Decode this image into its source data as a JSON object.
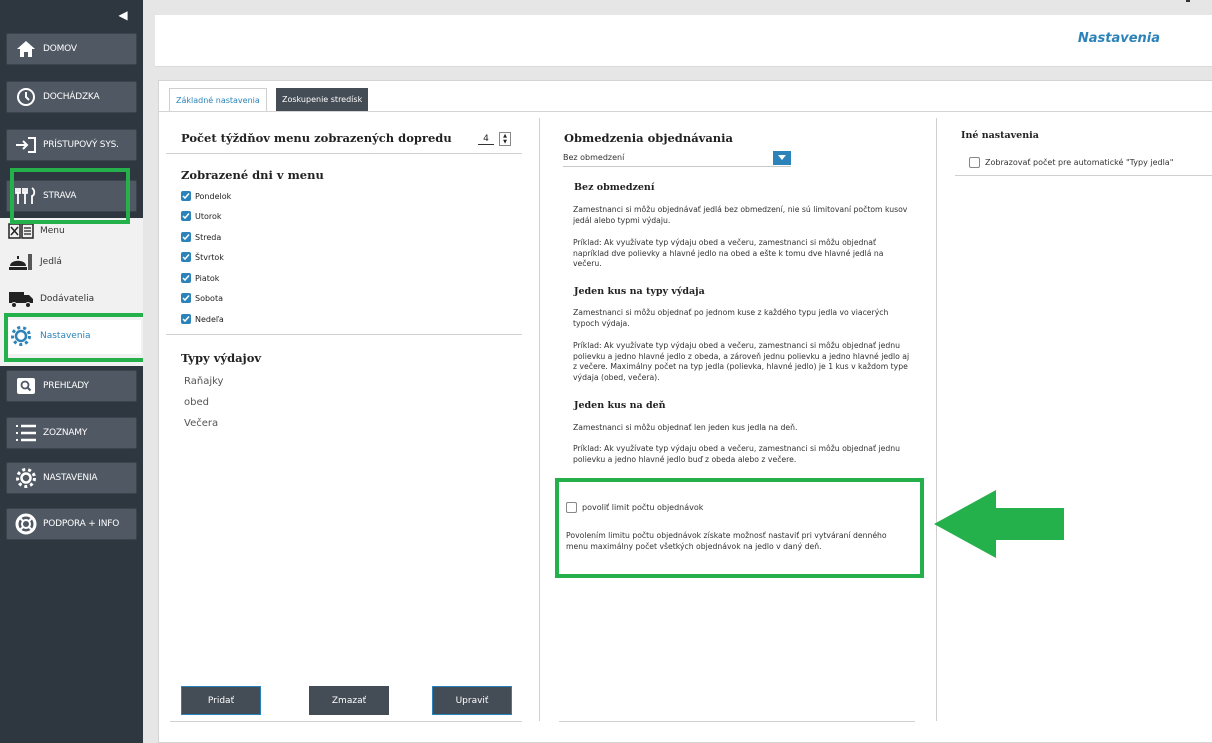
{
  "sidebar": {
    "collapse_icon": "caret-left-icon",
    "nav": [
      {
        "label": "DOMOV",
        "icon": "home-icon"
      },
      {
        "label": "DOCHÁDZKA",
        "icon": "clock-icon"
      },
      {
        "label": "PRÍSTUPOVÝ SYS.",
        "icon": "enter-icon"
      },
      {
        "label": "STRAVA",
        "icon": "cutlery-icon"
      }
    ],
    "strava_items": [
      {
        "label": "Menu",
        "icon": "menu-icon"
      },
      {
        "label": "Jedlá",
        "icon": "dish-icon"
      },
      {
        "label": "Dodávatelia",
        "icon": "truck-icon"
      },
      {
        "label": "Nastavenia",
        "icon": "gear-icon"
      }
    ],
    "nav_bottom": [
      {
        "label": "PREHĽADY",
        "icon": "search-icon"
      },
      {
        "label": "ZOZNAMY",
        "icon": "list-icon"
      },
      {
        "label": "NASTAVENIA",
        "icon": "gear-icon"
      },
      {
        "label": "PODPORA + INFO",
        "icon": "lifebuoy-icon"
      }
    ]
  },
  "header": {
    "title": "Nastavenia"
  },
  "tabs": [
    {
      "label": "Základné nastavenia",
      "active": true
    },
    {
      "label": "Zoskupenie stredísk",
      "active": false
    }
  ],
  "left": {
    "weeks_label": "Počet týždňov menu zobrazených dopredu",
    "weeks_value": "4",
    "days_title": "Zobrazené dni v menu",
    "days": [
      "Pondelok",
      "Utorok",
      "Streda",
      "Štvrtok",
      "Piatok",
      "Sobota",
      "Nedeľa"
    ],
    "types_title": "Typy výdajov",
    "types": [
      "Raňajky",
      "obed",
      "Večera"
    ],
    "buttons": {
      "add": "Pridať",
      "delete": "Zmazať",
      "edit": "Upraviť"
    }
  },
  "middle": {
    "title": "Obmedzenia objednávania",
    "select_value": "Bez obmedzení",
    "sections": [
      {
        "heading": "Bez obmedzení",
        "paragraphs": [
          "Zamestnanci si môžu objednávať jedlá bez obmedzení, nie sú limitovaní počtom kusov jedál alebo typmi výdaju.",
          "Príklad: Ak využívate typ výdaju obed a večeru, zamestnanci si môžu objednať napríklad dve polievky a hlavné jedlo na obed a ešte k tomu dve hlavné jedlá na večeru."
        ]
      },
      {
        "heading": "Jeden kus na typy výdaja",
        "paragraphs": [
          "Zamestnanci si môžu objednať po jednom kuse z každého typu jedla vo viacerých typoch výdaja.",
          "Príklad: Ak využívate typ výdaju obed a večeru, zamestnanci si môžu objednať jednu polievku a jedno hlavné jedlo z obeda, a zároveň jednu polievku a jedno hlavné jedlo aj z večere. Maximálny počet na typ jedla (polievka, hlavné jedlo) je 1 kus v každom type výdaja (obed, večera)."
        ]
      },
      {
        "heading": "Jeden kus na deň",
        "paragraphs": [
          "Zamestnanci si môžu objednať len jeden kus jedla na deň.",
          "Príklad: Ak využívate typ výdaju obed a večeru, zamestnanci si môžu objednať jednu polievku a jedno hlavné jedlo buď z obeda alebo z večere."
        ]
      }
    ],
    "limit_label": "povoliť limit počtu objednávok",
    "limit_description": "Povolením limitu počtu objednávok získate možnosť nastaviť pri vytváraní denného menu maximálny počet všetkých objednávok na jedlo v daný deň."
  },
  "right": {
    "title": "Iné nastavenia",
    "option_label": "Zobrazovať počet pre automatické \"Typy jedla\""
  },
  "colors": {
    "accent": "#2b83b9",
    "sidebar": "#2e363f",
    "highlight": "#24b04a",
    "button": "#444c55"
  }
}
